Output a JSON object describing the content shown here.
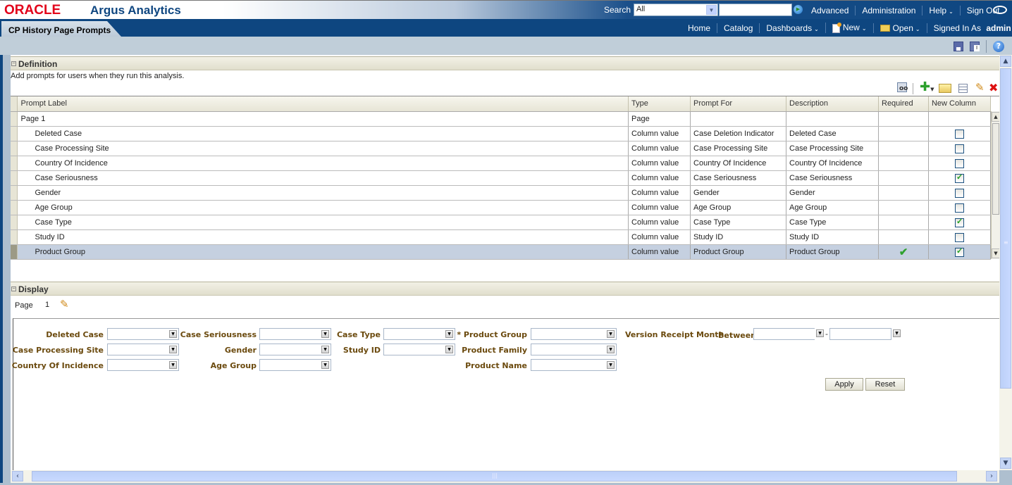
{
  "header": {
    "brand": "ORACLE",
    "app_title": "Argus Analytics",
    "search_label": "Search",
    "search_scope": "All",
    "search_value": "",
    "links": [
      "Advanced",
      "Administration",
      "Help",
      "Sign Out"
    ]
  },
  "nav": {
    "page_tab": "CP History Page Prompts",
    "links": [
      "Home",
      "Catalog",
      "Dashboards",
      "New",
      "Open"
    ],
    "signed_in_label": "Signed In As",
    "user": "admin"
  },
  "definition": {
    "title": "Definition",
    "description": "Add prompts for users when they run this analysis.",
    "columns": [
      "Prompt Label",
      "Type",
      "Prompt For",
      "Description",
      "Required",
      "New Column"
    ],
    "page_row": {
      "label": "Page 1",
      "type": "Page"
    },
    "rows": [
      {
        "label": "Deleted Case",
        "type": "Column value",
        "prompt_for": "Case Deletion Indicator",
        "description": "Deleted Case",
        "required": false,
        "new_column": false
      },
      {
        "label": "Case Processing Site",
        "type": "Column value",
        "prompt_for": "Case Processing Site",
        "description": "Case Processing Site",
        "required": false,
        "new_column": false
      },
      {
        "label": "Country Of Incidence",
        "type": "Column value",
        "prompt_for": "Country Of Incidence",
        "description": "Country Of Incidence",
        "required": false,
        "new_column": false
      },
      {
        "label": "Case Seriousness",
        "type": "Column value",
        "prompt_for": "Case Seriousness",
        "description": "Case Seriousness",
        "required": false,
        "new_column": true
      },
      {
        "label": "Gender",
        "type": "Column value",
        "prompt_for": "Gender",
        "description": "Gender",
        "required": false,
        "new_column": false
      },
      {
        "label": "Age Group",
        "type": "Column value",
        "prompt_for": "Age Group",
        "description": "Age Group",
        "required": false,
        "new_column": false
      },
      {
        "label": "Case Type",
        "type": "Column value",
        "prompt_for": "Case Type",
        "description": "Case Type",
        "required": false,
        "new_column": true
      },
      {
        "label": "Study ID",
        "type": "Column value",
        "prompt_for": "Study ID",
        "description": "Study ID",
        "required": false,
        "new_column": false
      },
      {
        "label": "Product Group",
        "type": "Column value",
        "prompt_for": "Product Group",
        "description": "Product Group",
        "required": true,
        "new_column": true,
        "selected": true
      }
    ]
  },
  "display": {
    "title": "Display",
    "page_label": "Page",
    "page_number": "1",
    "prompts": {
      "deleted_case": "Deleted Case",
      "case_processing_site": "Case Processing Site",
      "country_of_incidence": "Country Of Incidence",
      "case_seriousness": "Case Seriousness",
      "gender": "Gender",
      "age_group": "Age Group",
      "case_type": "Case Type",
      "study_id": "Study ID",
      "product_group": "* Product Group",
      "product_family": "Product Family",
      "product_name": "Product Name",
      "version_receipt_month": "Version Receipt Month",
      "between": "Between",
      "range_sep": "-"
    },
    "apply_label": "Apply",
    "reset_label": "Reset"
  },
  "icons": {
    "dropdown": "▼",
    "chevron_down": "⌄",
    "check": "✔",
    "pencil": "✎",
    "delete": "✖",
    "add": "✚",
    "help": "?",
    "scroll_up": "▲",
    "scroll_down": "▼",
    "scroll_left": "‹",
    "scroll_right": "›",
    "play": "▶",
    "collapse": "−"
  }
}
